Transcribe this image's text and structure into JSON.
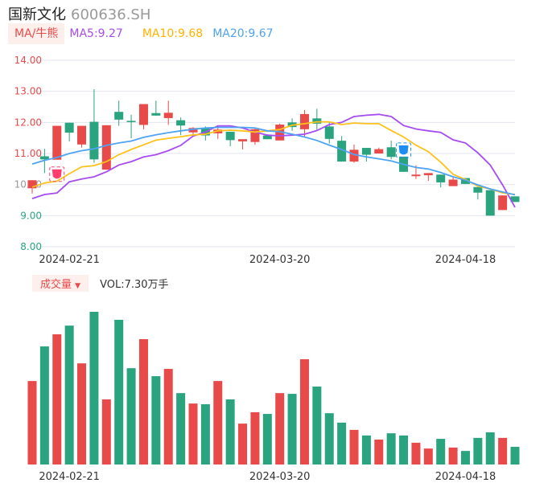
{
  "header": {
    "name": "国新文化",
    "code": "600636.SH"
  },
  "legend": {
    "button": "MA/牛熊",
    "ma5": "MA5:9.27",
    "ma10": "MA10:9.68",
    "ma20": "MA20:9.67"
  },
  "volume": {
    "button": "成交量",
    "caret": "▼",
    "label": "VOL:7.30万手"
  },
  "colors": {
    "up": "#e84a4a",
    "down": "#2aa37f",
    "ma5": "#a64cf0",
    "ma10": "#ffc21a",
    "ma20": "#4ea3f2",
    "grid": "#e2e6f0"
  },
  "markers": [
    {
      "type": "bull",
      "index": 2,
      "icon": "bull-badge-icon"
    },
    {
      "type": "bear",
      "index": 30,
      "icon": "bear-badge-icon"
    }
  ],
  "chart_data": [
    {
      "type": "candlestick",
      "ylim": [
        8,
        14
      ],
      "grid": true,
      "yticks": [
        "14.00",
        "13.00",
        "12.00",
        "11.00",
        "10.00",
        "9.00",
        "8.00"
      ],
      "xticks": [
        {
          "index": 3,
          "label": "2024-02-21"
        },
        {
          "index": 20,
          "label": "2024-03-20"
        },
        {
          "index": 35,
          "label": "2024-04-18"
        }
      ],
      "ohlc": [
        [
          9.88,
          10.14,
          9.71,
          10.14
        ],
        [
          10.91,
          11.15,
          10.37,
          10.81
        ],
        [
          10.8,
          11.89,
          10.8,
          11.89
        ],
        [
          11.99,
          11.99,
          11.39,
          11.67
        ],
        [
          11.29,
          11.89,
          11.19,
          11.89
        ],
        [
          12.02,
          13.07,
          10.7,
          10.81
        ],
        [
          10.48,
          11.91,
          10.48,
          11.91
        ],
        [
          12.34,
          12.7,
          11.89,
          12.09
        ],
        [
          12.05,
          12.25,
          11.49,
          12.01
        ],
        [
          11.92,
          12.59,
          11.78,
          12.59
        ],
        [
          12.3,
          12.7,
          12.22,
          12.22
        ],
        [
          12.14,
          12.7,
          11.92,
          12.31
        ],
        [
          12.07,
          12.16,
          11.59,
          11.9
        ],
        [
          11.68,
          11.85,
          11.54,
          11.82
        ],
        [
          11.82,
          11.87,
          11.42,
          11.58
        ],
        [
          11.65,
          11.87,
          11.47,
          11.77
        ],
        [
          11.7,
          11.7,
          11.23,
          11.43
        ],
        [
          11.39,
          11.46,
          11.13,
          11.46
        ],
        [
          11.37,
          11.82,
          11.28,
          11.78
        ],
        [
          11.58,
          11.62,
          11.46,
          11.46
        ],
        [
          11.42,
          11.96,
          11.42,
          11.93
        ],
        [
          12.0,
          12.13,
          11.73,
          11.85
        ],
        [
          11.78,
          12.4,
          11.53,
          12.27
        ],
        [
          12.13,
          12.44,
          11.77,
          11.96
        ],
        [
          11.87,
          12.0,
          11.32,
          11.47
        ],
        [
          11.41,
          11.56,
          10.74,
          10.74
        ],
        [
          10.74,
          11.29,
          10.7,
          11.12
        ],
        [
          11.18,
          11.18,
          10.74,
          10.96
        ],
        [
          11.0,
          11.19,
          11.0,
          11.14
        ],
        [
          11.2,
          11.41,
          10.82,
          10.89
        ],
        [
          10.9,
          10.9,
          10.41,
          10.41
        ],
        [
          10.27,
          10.62,
          10.18,
          10.32
        ],
        [
          10.3,
          10.37,
          10.12,
          10.37
        ],
        [
          10.32,
          10.32,
          9.91,
          10.07
        ],
        [
          9.95,
          10.26,
          9.95,
          10.16
        ],
        [
          10.21,
          10.21,
          10.02,
          10.02
        ],
        [
          9.92,
          9.92,
          9.52,
          9.74
        ],
        [
          9.82,
          9.82,
          9.0,
          9.0
        ],
        [
          9.18,
          9.65,
          9.18,
          9.65
        ],
        [
          9.62,
          9.62,
          9.44,
          9.44
        ]
      ],
      "series": [
        {
          "name": "MA5",
          "values": [
            9.55,
            9.68,
            9.73,
            10.09,
            10.18,
            10.25,
            10.41,
            10.63,
            10.74,
            10.89,
            10.96,
            11.09,
            11.26,
            11.56,
            11.69,
            11.89,
            11.89,
            11.82,
            11.69,
            11.59,
            11.57,
            11.59,
            11.62,
            11.74,
            11.93,
            12.0,
            12.19,
            12.23,
            12.26,
            12.19,
            11.9,
            11.79,
            11.73,
            11.68,
            11.44,
            11.34,
            11.02,
            10.63,
            9.99,
            9.27
          ]
        },
        {
          "name": "MA10",
          "values": [
            9.92,
            10.05,
            10.11,
            10.35,
            10.57,
            10.61,
            10.74,
            10.96,
            11.13,
            11.28,
            11.43,
            11.49,
            11.54,
            11.6,
            11.62,
            11.73,
            11.75,
            11.73,
            11.69,
            11.73,
            11.77,
            11.91,
            11.96,
            12.02,
            12.02,
            11.93,
            11.98,
            11.96,
            11.96,
            11.74,
            11.53,
            11.27,
            11.06,
            10.72,
            10.33,
            10.16,
            9.95,
            9.86,
            9.73,
            9.68
          ]
        },
        {
          "name": "MA20",
          "values": [
            10.66,
            10.78,
            10.87,
            11.0,
            11.09,
            11.15,
            11.26,
            11.34,
            11.4,
            11.52,
            11.6,
            11.67,
            11.73,
            11.78,
            11.82,
            11.84,
            11.84,
            11.84,
            11.82,
            11.73,
            11.7,
            11.62,
            11.53,
            11.42,
            11.27,
            11.13,
            10.97,
            10.89,
            10.83,
            10.76,
            10.65,
            10.55,
            10.5,
            10.39,
            10.25,
            10.14,
            9.99,
            9.86,
            9.76,
            9.67
          ]
        }
      ]
    },
    {
      "type": "bar",
      "unit": "万手",
      "values": [
        34.5,
        48.8,
        53.8,
        57.4,
        41.8,
        63.1,
        26.9,
        59.8,
        39.8,
        51.8,
        36.5,
        39.5,
        29.5,
        25.2,
        24.9,
        34.5,
        26.9,
        16.9,
        21.6,
        20.9,
        29.5,
        29.2,
        43.5,
        32.2,
        21.2,
        17.3,
        14.3,
        12.0,
        10.3,
        12.9,
        12.0,
        9.0,
        6.6,
        10.6,
        7.0,
        5.6,
        11.0,
        13.3,
        11.0,
        7.3
      ],
      "xticks": [
        {
          "index": 3,
          "label": "2024-02-21"
        },
        {
          "index": 20,
          "label": "2024-03-20"
        },
        {
          "index": 35,
          "label": "2024-04-18"
        }
      ]
    }
  ]
}
